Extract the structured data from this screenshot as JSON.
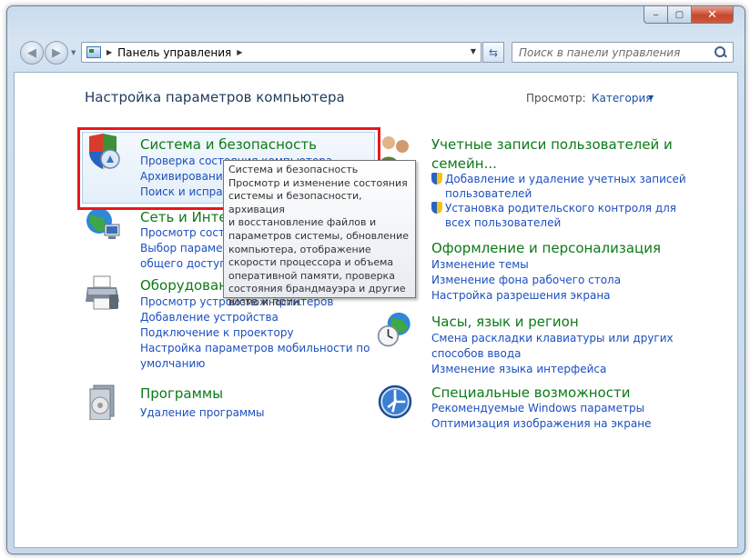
{
  "window": {
    "buttons": {
      "minimize": "‒",
      "maximize": "▢",
      "close": "✕"
    }
  },
  "navigation": {
    "back_icon": "back-arrow-icon",
    "forward_icon": "forward-arrow-icon",
    "address_icon": "control-panel-icon",
    "breadcrumb": "Панель управления",
    "search_placeholder": "Поиск в панели управления"
  },
  "page": {
    "heading": "Настройка параметров компьютера",
    "view_label": "Просмотр:",
    "view_value": "Категория"
  },
  "categories_left": [
    {
      "icon": "security-shield-icon",
      "title": "Система и безопасность",
      "links": [
        "Проверка состояния компьютера",
        "Архивирование данных компьютера",
        "Поиск и исправление проблем"
      ]
    },
    {
      "icon": "network-globe-icon",
      "title": "Сеть и Интернет",
      "links": [
        "Просмотр состояния сети и задач",
        "Выбор параметров домашней группы и",
        "общего доступа"
      ]
    },
    {
      "icon": "printer-icon",
      "title": "Оборудование и звук",
      "links": [
        "Просмотр устройств и принтеров",
        "Добавление устройства",
        "Подключение к проектору",
        "Настройка параметров мобильности по",
        "умолчанию"
      ]
    },
    {
      "icon": "programs-icon",
      "title": "Программы",
      "links": [
        "Удаление программы"
      ]
    }
  ],
  "categories_right": [
    {
      "icon": "user-accounts-icon",
      "title_lines": [
        "Учетные записи пользователей и",
        "семейн..."
      ],
      "links": [
        "Добавление и удаление учетных записей",
        "пользователей",
        "Установка родительского контроля для",
        "всех пользователей"
      ]
    },
    {
      "icon": "appearance-icon",
      "title": "Оформление и персонализация",
      "links": [
        "Изменение темы",
        "Изменение фона рабочего стола",
        "Настройка разрешения экрана"
      ]
    },
    {
      "icon": "clock-globe-icon",
      "title": "Часы, язык и регион",
      "links": [
        "Смена раскладки клавиатуры или других",
        "способов ввода",
        "Изменение языка интерфейса"
      ]
    },
    {
      "icon": "accessibility-icon",
      "title": "Специальные возможности",
      "links": [
        "Рекомендуемые Windows параметры",
        "Оптимизация изображения на экране"
      ]
    }
  ],
  "tooltip": {
    "title": "Система и безопасность",
    "lines": [
      "Просмотр и изменение состояния",
      "системы и безопасности, архивация",
      "и восстановление файлов и",
      "параметров системы, обновление",
      "компьютера, отображение",
      "скорости процессора и объема",
      "оперативной памяти, проверка",
      "состояния брандмауэра и другие",
      "возможности."
    ]
  },
  "colors": {
    "category_title": "#0c7a18",
    "link": "#1c4fbf",
    "heading": "#1e395b",
    "highlight_border": "#e8181b"
  }
}
